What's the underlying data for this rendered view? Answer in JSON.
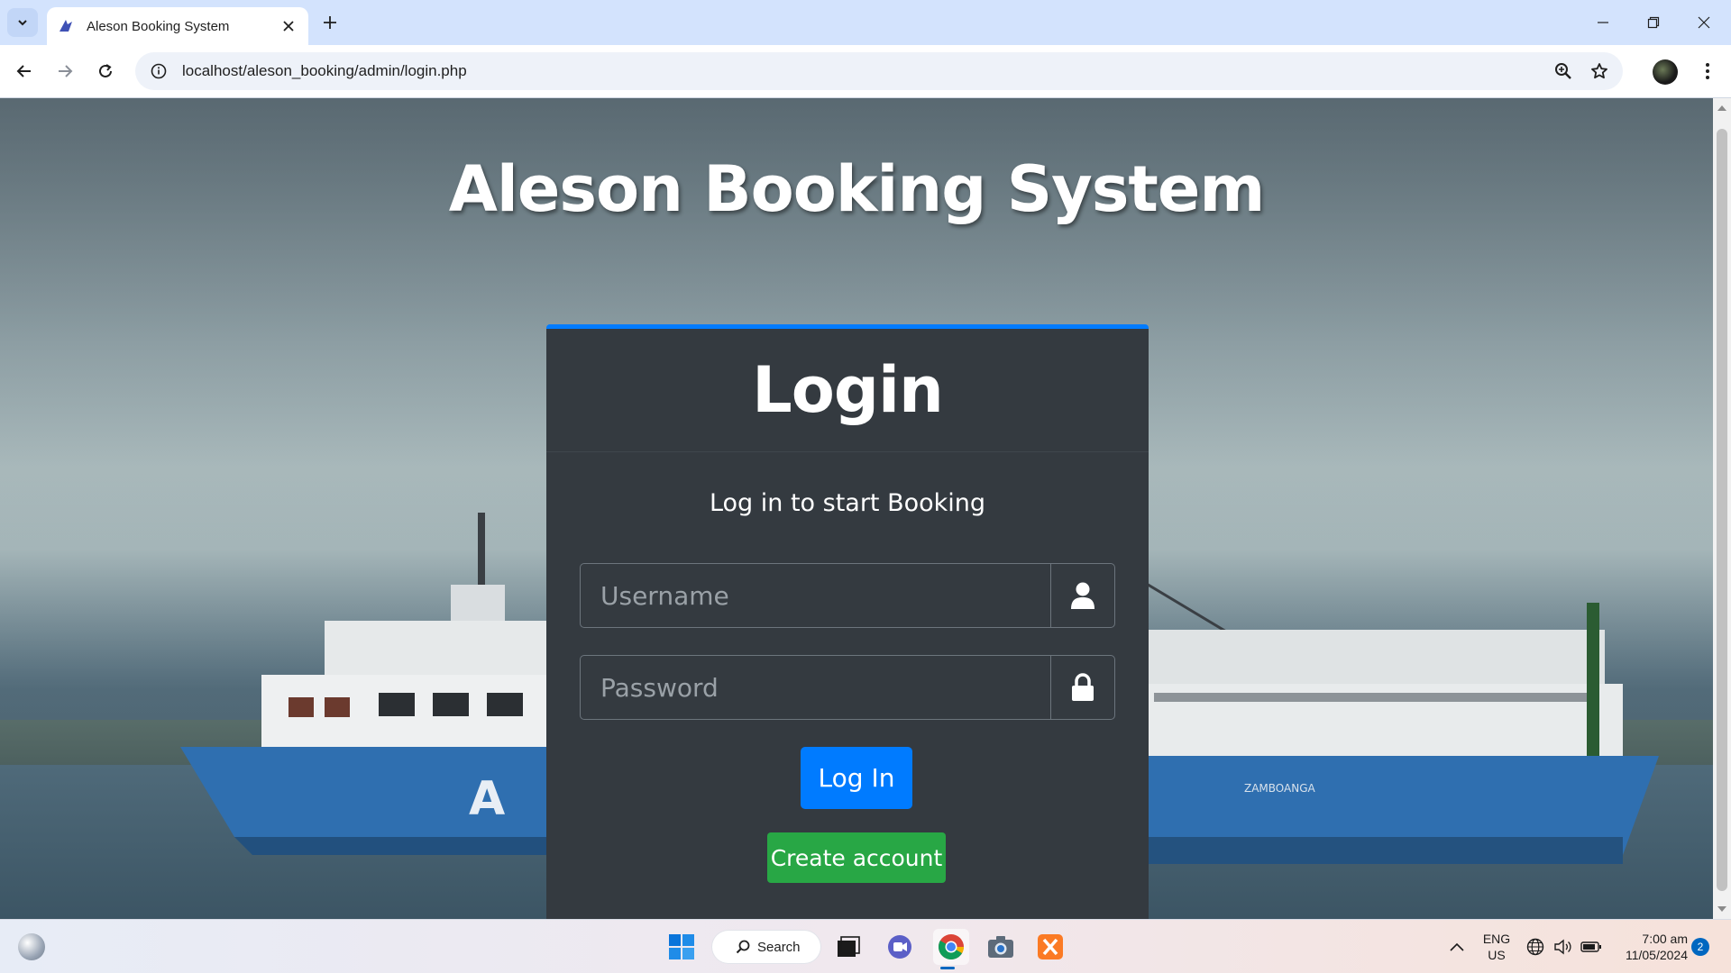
{
  "browser": {
    "tab_title": "Aleson Booking System",
    "url": "localhost/aleson_booking/admin/login.php"
  },
  "page": {
    "heading": "Aleson Booking System",
    "card_title": "Login",
    "subtitle": "Log in to start Booking",
    "username_placeholder": "Username",
    "password_placeholder": "Password",
    "login_label": "Log In",
    "create_label": "Create account"
  },
  "taskbar": {
    "search_label": "Search",
    "lang_line1": "ENG",
    "lang_line2": "US",
    "time": "7:00 am",
    "date": "11/05/2024",
    "notification_count": "2"
  },
  "colors": {
    "primary": "#007bff",
    "success": "#28a745",
    "card_bg": "#343a40"
  }
}
